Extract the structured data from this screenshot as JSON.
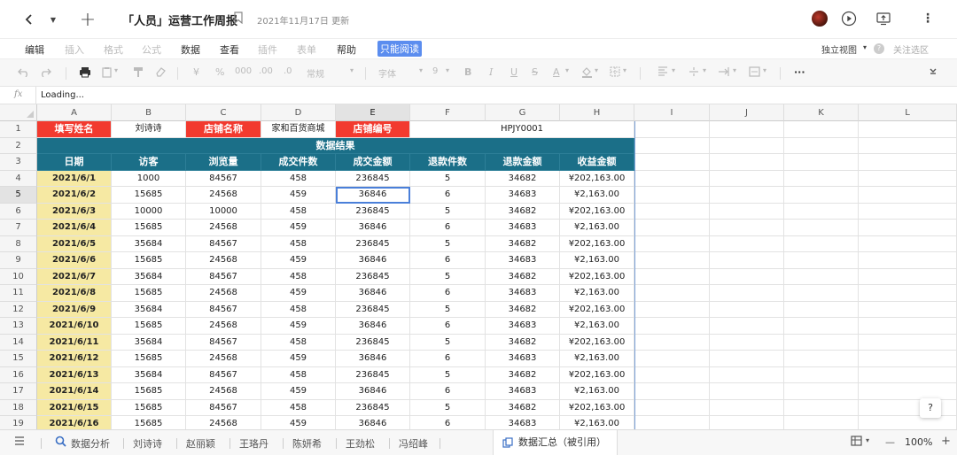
{
  "header": {
    "title": "「人员」运营工作周报",
    "updated": "2021年11月17日 更新"
  },
  "menu": {
    "items": [
      {
        "label": "编辑",
        "dim": false
      },
      {
        "label": "插入",
        "dim": true
      },
      {
        "label": "格式",
        "dim": true
      },
      {
        "label": "公式",
        "dim": true
      },
      {
        "label": "数据",
        "dim": false
      },
      {
        "label": "查看",
        "dim": false
      },
      {
        "label": "插件",
        "dim": true
      },
      {
        "label": "表单",
        "dim": true
      },
      {
        "label": "帮助",
        "dim": false
      }
    ],
    "readonly_label": "只能阅读",
    "view_label": "独立视图",
    "focus_label": "关注选区"
  },
  "toolbar": {
    "font_label": "字体",
    "size_label": "9",
    "format_label": "常规",
    "currency": "¥",
    "percent": "%",
    "thousands": "000",
    "dec_inc": ".00",
    "dec_dec": ".0"
  },
  "formula": {
    "fx": "fx",
    "content": "Loading..."
  },
  "grid": {
    "columns": [
      "A",
      "B",
      "C",
      "D",
      "E",
      "F",
      "G",
      "H",
      "I",
      "J",
      "K",
      "L"
    ],
    "rows": [
      "1",
      "2",
      "3",
      "4",
      "5",
      "6",
      "7",
      "8",
      "9",
      "10",
      "11",
      "12",
      "13",
      "14",
      "15",
      "16",
      "17",
      "18",
      "19"
    ],
    "row1": {
      "label_name": "填写姓名",
      "name": "刘诗诗",
      "label_store": "店铺名称",
      "store": "家和百货商城",
      "label_code": "店铺编号",
      "code": "HPJY0001"
    },
    "section_title": "数据结果",
    "headers": [
      "日期",
      "访客",
      "浏览量",
      "成交件数",
      "成交金额",
      "退款件数",
      "退款金额",
      "收益金额"
    ],
    "records": [
      [
        "2021/6/1",
        "1000",
        "84567",
        "458",
        "236845",
        "5",
        "34682",
        "¥202,163.00"
      ],
      [
        "2021/6/2",
        "15685",
        "24568",
        "459",
        "36846",
        "6",
        "34683",
        "¥2,163.00"
      ],
      [
        "2021/6/3",
        "10000",
        "10000",
        "458",
        "236845",
        "5",
        "34682",
        "¥202,163.00"
      ],
      [
        "2021/6/4",
        "15685",
        "24568",
        "459",
        "36846",
        "6",
        "34683",
        "¥2,163.00"
      ],
      [
        "2021/6/5",
        "35684",
        "84567",
        "458",
        "236845",
        "5",
        "34682",
        "¥202,163.00"
      ],
      [
        "2021/6/6",
        "15685",
        "24568",
        "459",
        "36846",
        "6",
        "34683",
        "¥2,163.00"
      ],
      [
        "2021/6/7",
        "35684",
        "84567",
        "458",
        "236845",
        "5",
        "34682",
        "¥202,163.00"
      ],
      [
        "2021/6/8",
        "15685",
        "24568",
        "459",
        "36846",
        "6",
        "34683",
        "¥2,163.00"
      ],
      [
        "2021/6/9",
        "35684",
        "84567",
        "458",
        "236845",
        "5",
        "34682",
        "¥202,163.00"
      ],
      [
        "2021/6/10",
        "15685",
        "24568",
        "459",
        "36846",
        "6",
        "34683",
        "¥2,163.00"
      ],
      [
        "2021/6/11",
        "35684",
        "84567",
        "458",
        "236845",
        "5",
        "34682",
        "¥202,163.00"
      ],
      [
        "2021/6/12",
        "15685",
        "24568",
        "459",
        "36846",
        "6",
        "34683",
        "¥2,163.00"
      ],
      [
        "2021/6/13",
        "35684",
        "84567",
        "458",
        "236845",
        "5",
        "34682",
        "¥202,163.00"
      ],
      [
        "2021/6/14",
        "15685",
        "24568",
        "459",
        "36846",
        "6",
        "34683",
        "¥2,163.00"
      ],
      [
        "2021/6/15",
        "15685",
        "84567",
        "458",
        "236845",
        "5",
        "34682",
        "¥202,163.00"
      ],
      [
        "2021/6/16",
        "15685",
        "24568",
        "459",
        "36846",
        "6",
        "34683",
        "¥2,163.00"
      ]
    ],
    "active_cell": "E5"
  },
  "sheets": {
    "tabs": [
      "数据分析",
      "刘诗诗",
      "赵丽颖",
      "王珞丹",
      "陈妍希",
      "王劲松",
      "冯绍峰"
    ],
    "active": "数据汇总（被引用）",
    "zoom": "100%",
    "minus": "—",
    "plus": "+"
  },
  "colors": {
    "label_red": "#f23a2f",
    "header_teal": "#1b6f88",
    "date_yellow": "#f6e9a3",
    "readonly_blue": "#5b8def"
  }
}
